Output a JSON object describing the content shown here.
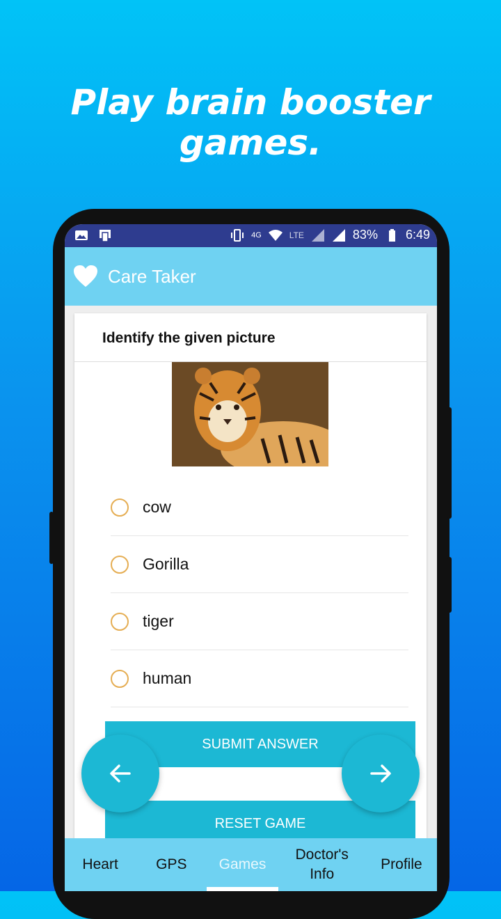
{
  "headline": "Play brain booster games.",
  "status_bar": {
    "network": "4G",
    "lte": "LTE",
    "battery": "83%",
    "time": "6:49"
  },
  "app_bar": {
    "title": "Care Taker",
    "icon": "heart-icon"
  },
  "quiz": {
    "question": "Identify the given picture",
    "picture_subject": "tiger",
    "options": [
      "cow",
      "Gorilla",
      "tiger",
      "human"
    ],
    "submit_label": "SUBMIT ANSWER",
    "reset_label": "RESET GAME"
  },
  "navigation": {
    "prev_icon": "arrow-left-icon",
    "next_icon": "arrow-right-icon"
  },
  "bottom_nav": {
    "items": [
      {
        "label": "Heart"
      },
      {
        "label": "GPS"
      },
      {
        "label": "Games",
        "active": true
      },
      {
        "label": "Doctor's Info"
      },
      {
        "label": "Profile"
      }
    ]
  },
  "colors": {
    "status_bar": "#2e3c8f",
    "app_bar": "#6fd2f2",
    "button": "#1cb8d4",
    "radio": "#e5ad52"
  }
}
